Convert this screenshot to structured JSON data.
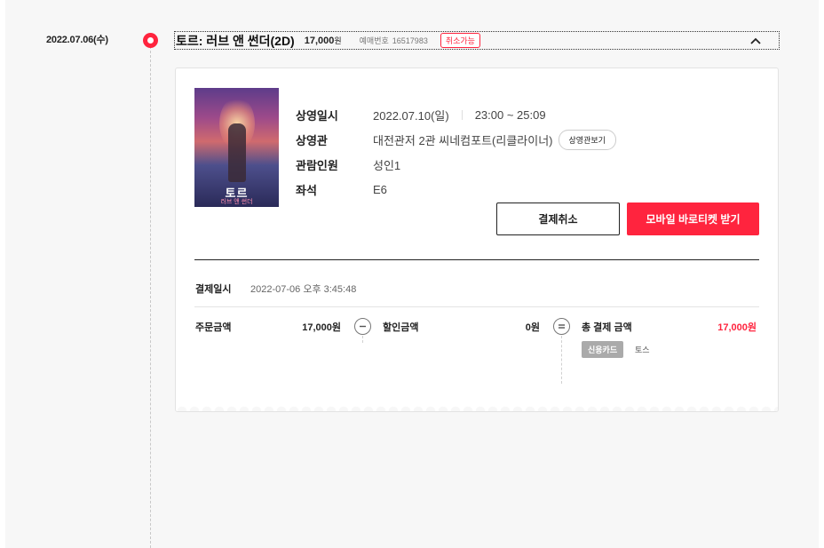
{
  "booking": {
    "date": "2022.07.06(수)",
    "movie_title": "토르: 러브 앤 썬더(2D)",
    "price_amount": "17,000",
    "price_unit": "원",
    "booking_label": "예매번호",
    "booking_number": "16517983",
    "status_badge": "취소가능",
    "poster": {
      "title": "토르",
      "subtitle": "러브 앤 썬더"
    },
    "details": [
      {
        "label": "상영일시",
        "value": "2022.07.10(일)",
        "value2": "23:00 ~ 25:09"
      },
      {
        "label": "상영관",
        "value": "대전관저 2관 씨네컴포트(리클라이너)",
        "button": "상영관보기"
      },
      {
        "label": "관람인원",
        "value": "성인1"
      },
      {
        "label": "좌석",
        "value": "E6"
      }
    ],
    "actions": {
      "cancel": "결제취소",
      "ticket": "모바일 바로티켓 받기"
    },
    "payment": {
      "date_label": "결제일시",
      "date_value": "2022-07-06 오후 3:45:48",
      "order_label": "주문금액",
      "order_value": "17,000원",
      "discount_label": "할인금액",
      "discount_value": "0원",
      "total_label": "총 결제 금액",
      "total_value": "17,000원",
      "method": "신용카드",
      "provider": "토스"
    }
  },
  "colors": {
    "accent": "#ff243e",
    "background": "#f7f7f7",
    "card": "#ffffff"
  },
  "icons": {
    "collapse": "chevron-up-icon",
    "minus": "minus-icon",
    "equals": "equals-icon",
    "timeline": "timeline-dot-icon"
  }
}
